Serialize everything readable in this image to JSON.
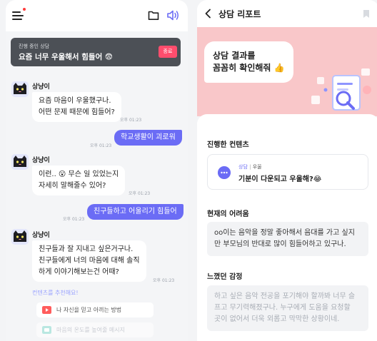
{
  "left": {
    "session": {
      "label": "진행 중인 상담",
      "title": "요즘 너무 우울해서 힘들어 😨",
      "end_button": "종료"
    },
    "messages": [
      {
        "bot_name": "상냥이",
        "lines": [
          "요즘 마음이 우울했구나.",
          "어떤 문제 때문에 힘들어?"
        ],
        "time": "오후 01:23"
      },
      {
        "user": "학교생활이 괴로워",
        "time": "오후 01:23"
      },
      {
        "bot_name": "상냥이",
        "lines": [
          "이런.. 😮 무슨 일 있었는지",
          "자세히 말해줄수 있어?"
        ],
        "time": "오후 01:23"
      },
      {
        "user": "친구들하고 어울리기 힘들어",
        "time": "오후 01:23"
      },
      {
        "bot_name": "상냥이",
        "lines": [
          "친구들과 잘 지내고 싶은거구나.",
          "친구들에게 너의 마음에 대해 솔직",
          "하게 이야기해보는건 어때?"
        ],
        "time": "오후 01:23"
      }
    ],
    "recommend_label": "컨텐츠를 추천해요!",
    "recommendations": [
      {
        "label": "나 자신을 믿고 아끼는 방법",
        "icon": "play-icon",
        "color": "#ff5c5c"
      },
      {
        "label": "마음의 온도를 높여줄 메시지",
        "icon": "message-icon",
        "color": "#7fd3c8"
      }
    ],
    "colors": {
      "user_bubble": "#6b6cf5",
      "session_card": "#4c5056",
      "end_button": "#ff4d6d"
    }
  },
  "right": {
    "header": {
      "title": "상담 리포트"
    },
    "banner": {
      "lines": [
        "상담 결과를",
        "꼼꼼히 확인해줘 👍"
      ],
      "color": "#f9c7c9"
    },
    "sections": {
      "content_title": "진행한 컨텐츠",
      "content": {
        "tag": "상담",
        "separator": "|",
        "category": "우울",
        "name": "기분이 다운되고 우울해?😂"
      },
      "difficulty_title": "현재의 어려움",
      "difficulty_lines": [
        "oo이는 음악을 정말 좋아해서 음대를 가고 싶지",
        "만 부모님의 반대로 많이 힘들어하고 있구나."
      ],
      "feeling_title": "느꼈던 감정",
      "feeling_lines": [
        "하고 싶은 음악 전공을 포기해야 할까봐 너무 슬",
        "프고 무기력해졌구나. 누구에게 도움을 요청할",
        "곳이 없어서 더욱 외롭고 막막한 상황이네."
      ]
    }
  }
}
